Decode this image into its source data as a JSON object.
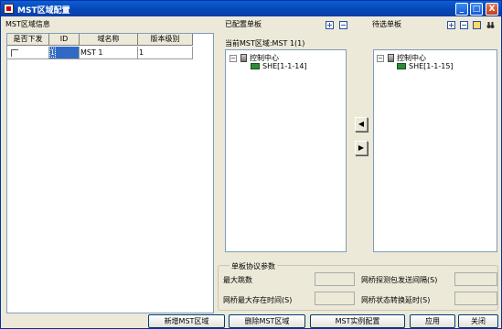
{
  "window": {
    "title": "MST区域配置",
    "minimize": "_",
    "maximize": "□",
    "close": "X"
  },
  "left": {
    "section_title": "MST区域信息",
    "columns": [
      "是否下发",
      "ID",
      "域名称",
      "版本级别"
    ],
    "rows": [
      {
        "checked": false,
        "id": "1",
        "name": "MST 1",
        "version": "1"
      }
    ]
  },
  "configured": {
    "title": "已配置单板",
    "current_area": "当前MST区域:MST 1(1)",
    "tree_root": "控制中心",
    "tree_child": "SHE[1-1-14]"
  },
  "pending": {
    "title": "待选单板",
    "tree_root": "控制中心",
    "tree_child": "SHE[1-1-15]"
  },
  "arrows": {
    "left": "◀",
    "right": "▶"
  },
  "params": {
    "title": "单板协议参数",
    "max_hops": "最大跳数",
    "bridge_max_age": "网桥最大存在时间(S)",
    "hello_interval": "网桥探测包发送间隔(S)",
    "forward_delay": "网桥状态转换延时(S)"
  },
  "buttons": {
    "add": "新增MST区域",
    "delete": "删除MST区域",
    "instance": "MST实例配置",
    "apply": "应用",
    "close": "关闭"
  },
  "tree_expander": "−",
  "tools": {
    "expand": "+",
    "collapse": "−"
  }
}
